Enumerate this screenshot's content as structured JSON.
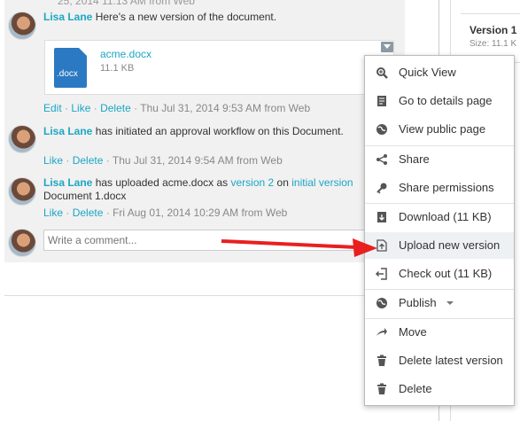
{
  "clipped_top": "25, 2014 11:13 AM from Web",
  "post1": {
    "author": "Lisa Lane",
    "text": "Here's a new version of the document.",
    "file": {
      "ext": ".docx",
      "name": "acme.docx",
      "size": "11.1 KB"
    },
    "actions": {
      "edit": "Edit",
      "like": "Like",
      "delete": "Delete",
      "dot": "·"
    },
    "timestamp": "Thu Jul 31, 2014 9:53 AM",
    "source": "from Web"
  },
  "post2": {
    "author": "Lisa Lane",
    "text": "has initiated an approval workflow on this Document.",
    "actions": {
      "like": "Like",
      "delete": "Delete"
    },
    "timestamp": "Thu Jul 31, 2014 9:54 AM",
    "source": "from Web"
  },
  "post3": {
    "author": "Lisa Lane",
    "text_a": "has uploaded acme.docx as",
    "link_version": "version 2",
    "text_b": "on",
    "link_initial": "initial version",
    "text_line2": "Document 1.docx",
    "actions": {
      "like": "Like",
      "delete": "Delete"
    },
    "timestamp": "Fri Aug 01, 2014 10:29 AM",
    "source": "from Web"
  },
  "comment": {
    "placeholder": "Write a comment..."
  },
  "side_panel": {
    "title": "Version 1",
    "size": "Size: 11.1 K"
  },
  "menu": {
    "items": [
      {
        "label": "Quick View",
        "icon": "zoom-icon"
      },
      {
        "label": "Go to details page",
        "icon": "document-icon"
      },
      {
        "label": "View public page",
        "icon": "globe-icon"
      },
      {
        "label": "Share",
        "icon": "share-icon"
      },
      {
        "label": "Share permissions",
        "icon": "key-icon"
      },
      {
        "label": "Download (11 KB)",
        "icon": "download-icon"
      },
      {
        "label": "Upload new version",
        "icon": "upload-icon",
        "highlighted": true
      },
      {
        "label": "Check out (11 KB)",
        "icon": "checkout-icon"
      },
      {
        "label": "Publish",
        "icon": "globe-icon"
      },
      {
        "label": "Move",
        "icon": "move-arrow-icon"
      },
      {
        "label": "Delete latest version",
        "icon": "trash-icon"
      },
      {
        "label": "Delete",
        "icon": "trash-icon"
      }
    ]
  },
  "colors": {
    "link": "#1ca6c4",
    "arrow": "#e8201f",
    "file_icon": "#2b79c2"
  }
}
